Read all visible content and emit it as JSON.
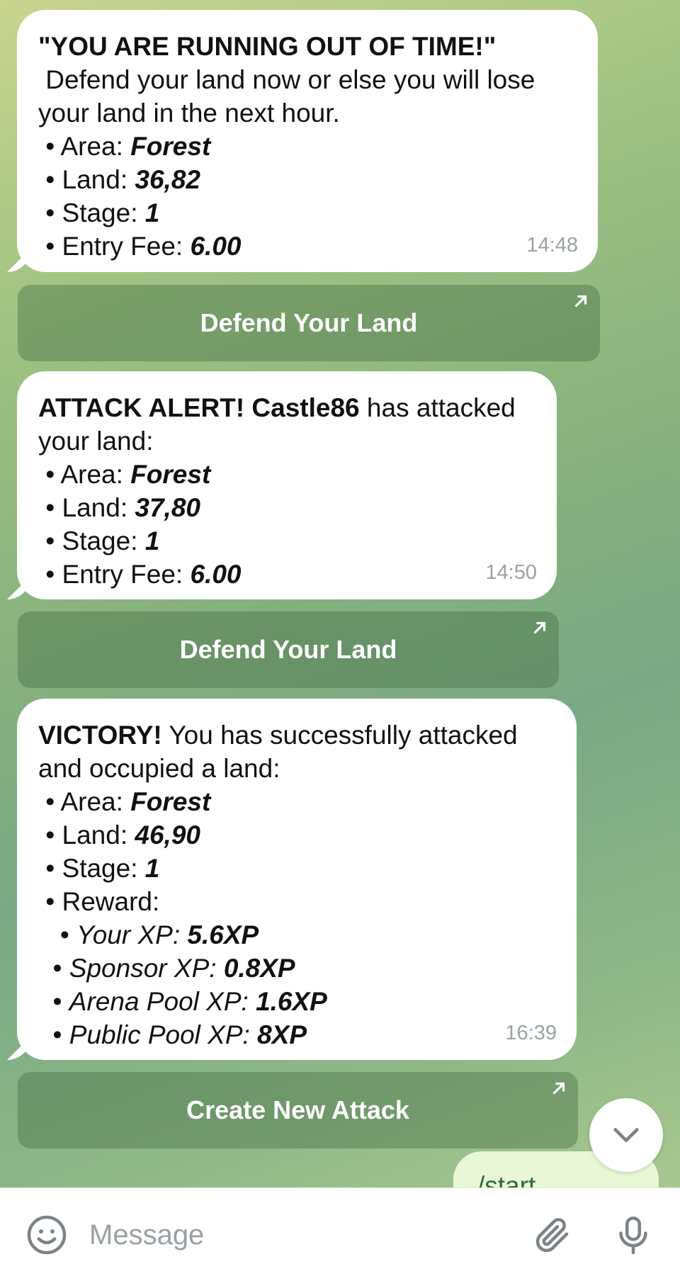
{
  "messages": [
    {
      "lines": [
        {
          "parts": [
            {
              "t": "\"YOU ARE RUNNING OUT OF TIME!\"",
              "s": "b"
            }
          ]
        },
        {
          "parts": [
            {
              "t": " Defend your land now or else you will lose",
              "s": ""
            }
          ]
        },
        {
          "parts": [
            {
              "t": "your land in the next hour.",
              "s": ""
            }
          ]
        },
        {
          "parts": [
            {
              "t": " • Area: ",
              "s": ""
            },
            {
              "t": "Forest",
              "s": "bi"
            }
          ]
        },
        {
          "parts": [
            {
              "t": " • Land: ",
              "s": ""
            },
            {
              "t": "36,82",
              "s": "bi"
            }
          ]
        },
        {
          "parts": [
            {
              "t": " • Stage: ",
              "s": ""
            },
            {
              "t": "1",
              "s": "bi"
            }
          ]
        },
        {
          "parts": [
            {
              "t": " • Entry Fee: ",
              "s": ""
            },
            {
              "t": "6.00",
              "s": "bi"
            }
          ]
        }
      ],
      "time": "14:48",
      "button": "Defend Your Land"
    },
    {
      "lines": [
        {
          "parts": [
            {
              "t": "ATTACK ALERT! Castle86",
              "s": "b"
            },
            {
              "t": " has attacked",
              "s": ""
            }
          ]
        },
        {
          "parts": [
            {
              "t": "your land:",
              "s": ""
            }
          ]
        },
        {
          "parts": [
            {
              "t": " • Area: ",
              "s": ""
            },
            {
              "t": "Forest",
              "s": "bi"
            }
          ]
        },
        {
          "parts": [
            {
              "t": " • Land: ",
              "s": ""
            },
            {
              "t": "37,80",
              "s": "bi"
            }
          ]
        },
        {
          "parts": [
            {
              "t": " • Stage: ",
              "s": ""
            },
            {
              "t": "1",
              "s": "bi"
            }
          ]
        },
        {
          "parts": [
            {
              "t": " • Entry Fee: ",
              "s": ""
            },
            {
              "t": "6.00",
              "s": "bi"
            }
          ]
        }
      ],
      "time": "14:50",
      "button": "Defend Your Land"
    },
    {
      "lines": [
        {
          "parts": [
            {
              "t": "VICTORY!",
              "s": "b"
            },
            {
              "t": " You has successfully attacked",
              "s": ""
            }
          ]
        },
        {
          "parts": [
            {
              "t": "and occupied a land:",
              "s": ""
            }
          ]
        },
        {
          "parts": [
            {
              "t": " • Area: ",
              "s": ""
            },
            {
              "t": "Forest",
              "s": "bi"
            }
          ]
        },
        {
          "parts": [
            {
              "t": " • Land: ",
              "s": ""
            },
            {
              "t": "46,90",
              "s": "bi"
            }
          ]
        },
        {
          "parts": [
            {
              "t": " • Stage: ",
              "s": ""
            },
            {
              "t": "1",
              "s": "bi"
            }
          ]
        },
        {
          "parts": [
            {
              "t": " • Reward:",
              "s": ""
            }
          ]
        },
        {
          "parts": [
            {
              "t": "   • ",
              "s": ""
            },
            {
              "t": "Your XP: ",
              "s": "it"
            },
            {
              "t": "5.6XP",
              "s": "bi"
            }
          ]
        },
        {
          "parts": [
            {
              "t": "  • ",
              "s": ""
            },
            {
              "t": "Sponsor XP: ",
              "s": "it"
            },
            {
              "t": "0.8XP",
              "s": "bi"
            }
          ]
        },
        {
          "parts": [
            {
              "t": "  • ",
              "s": ""
            },
            {
              "t": "Arena Pool XP: ",
              "s": "it"
            },
            {
              "t": "1.6XP",
              "s": "bi"
            }
          ]
        },
        {
          "parts": [
            {
              "t": "  • ",
              "s": ""
            },
            {
              "t": "Public Pool XP: ",
              "s": "it"
            },
            {
              "t": "8XP",
              "s": "bi"
            }
          ]
        }
      ],
      "time": "16:39",
      "button": "Create New Attack"
    }
  ],
  "partial_outgoing": "/start",
  "composer": {
    "placeholder": "Message",
    "emoji_icon": "emoji-icon",
    "attach_icon": "paperclip-icon",
    "mic_icon": "microphone-icon"
  },
  "scroll_icon": "chevron-down-icon",
  "colors": {
    "bubble": "#ffffff",
    "button_overlay": "rgba(70,110,70,0.42)",
    "time": "#9aa3a0"
  }
}
